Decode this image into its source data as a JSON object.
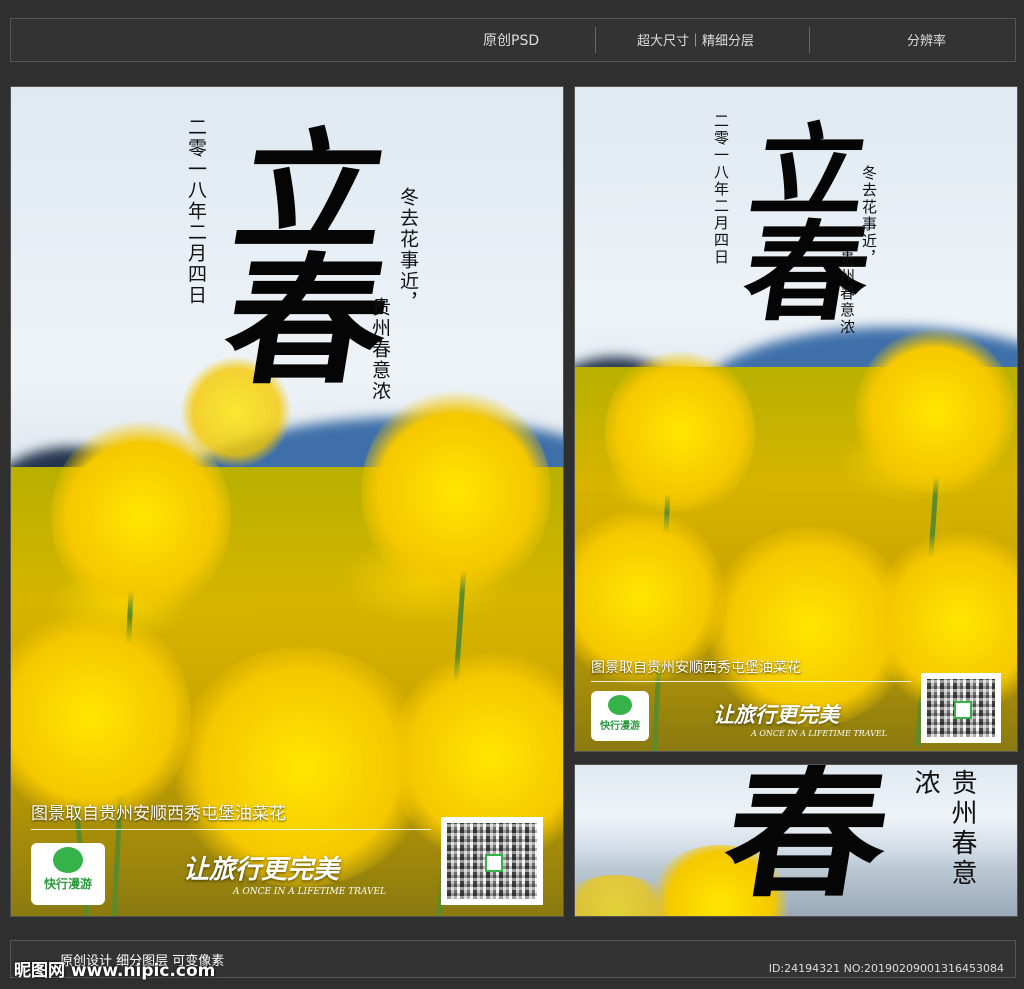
{
  "topbar": {
    "original": "原创PSD",
    "size": "超大尺寸｜精细分层",
    "resolution": "分辨率"
  },
  "poster": {
    "date": "二零一八年二月四日",
    "title_char_1": "立",
    "title_char_2": "春",
    "poem_line_1": "冬去花事近，",
    "poem_line_2": "贵州春意浓",
    "caption": "图景取自贵州安顺西秀屯堡油菜花",
    "slogan": "让旅行更完美",
    "slogan_en": "A ONCE IN A LIFETIME TRAVEL",
    "logo_name": "快行漫游"
  },
  "banner": {
    "title_char": "春",
    "poem": "贵州春意浓"
  },
  "footer": {
    "watermark": "昵图网 www.nipic.com",
    "description": "原创设计 细分图层 可变像素",
    "id": "ID:24194321 NO:20190209001316453084"
  },
  "colors": {
    "background": "#2f2f2f",
    "rapeseed": "#f5c800",
    "mountain": "#3e6fa9",
    "logo_green": "#35b24a"
  }
}
